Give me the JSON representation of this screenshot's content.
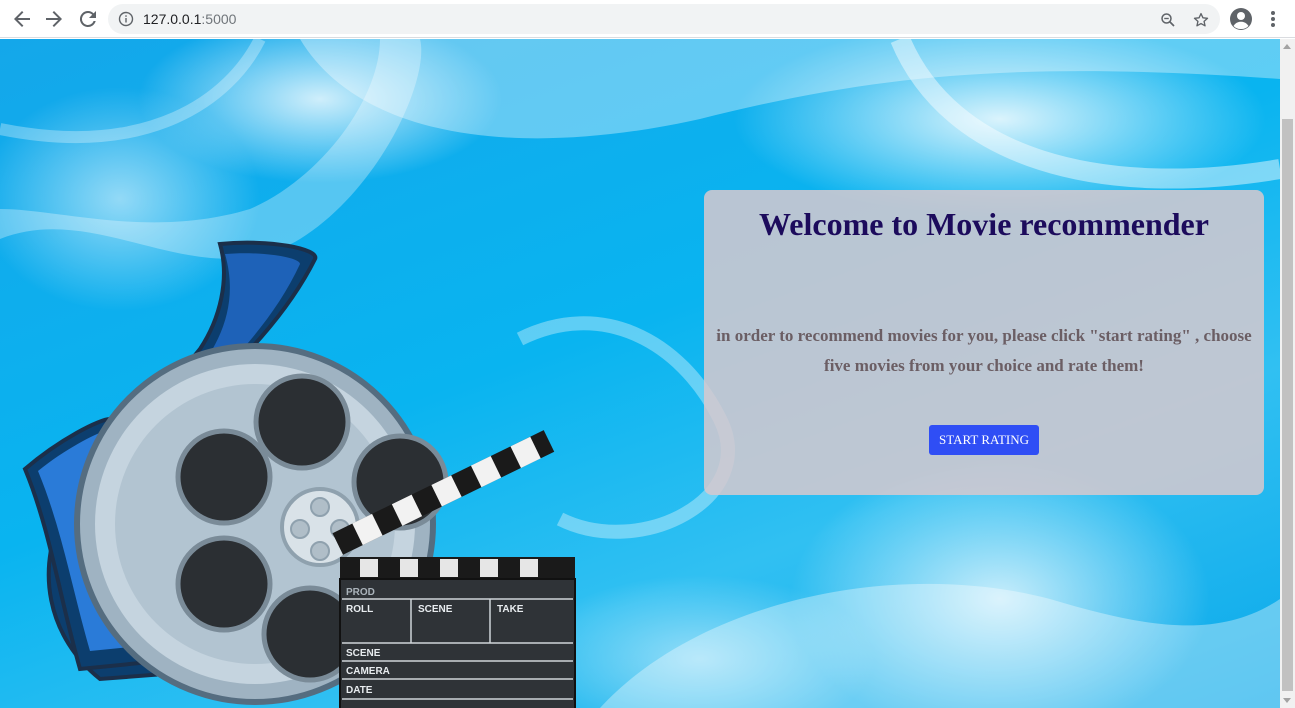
{
  "browser": {
    "url_host": "127.0.0.1",
    "url_port": ":5000"
  },
  "page": {
    "title": "Welcome to Movie recommender",
    "description": "in order to recommend movies for you, please click \"start rating\" , choose five movies from your choice and rate them!",
    "button_label": "START RATING"
  },
  "clapperboard": {
    "prod": "PROD",
    "roll": "ROLL",
    "scene": "SCENE",
    "take": "TAKE",
    "scene2": "SCENE",
    "camera": "CAMERA",
    "date": "DATE"
  },
  "colors": {
    "button": "#2f4ef5",
    "title": "#1c0b5c",
    "card": "#d6c8ce"
  }
}
